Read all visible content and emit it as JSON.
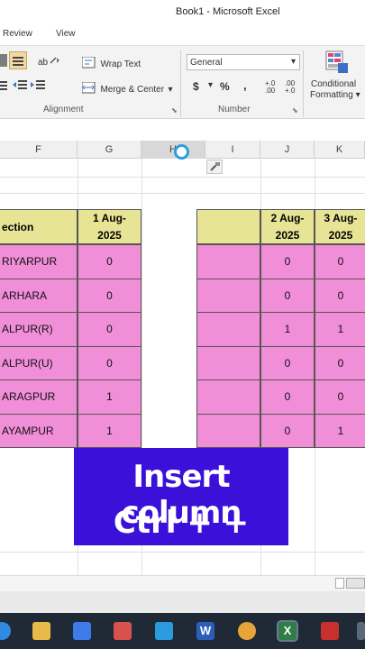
{
  "window": {
    "title": "Book1 - Microsoft Excel"
  },
  "tabs": [
    "Review",
    "View"
  ],
  "ribbon": {
    "alignment": {
      "wrap_text": "Wrap Text",
      "merge_center": "Merge & Center",
      "group_label": "Alignment"
    },
    "number": {
      "format_value": "General",
      "currency": "$",
      "percent": "%",
      "comma": ",",
      "inc_decimal": "+.0 .00",
      "dec_decimal": ".00 +.0",
      "group_label": "Number"
    },
    "styles": {
      "conditional_formatting_line1": "Conditional",
      "conditional_formatting_line2": "Formatting"
    }
  },
  "columns": [
    "F",
    "G",
    "H",
    "I",
    "J",
    "K"
  ],
  "sheet": {
    "left_header": "ection",
    "g_header_line1": "1 Aug-",
    "g_header_line2": "2025",
    "j_header_line1": "2 Aug-",
    "j_header_line2": "2025",
    "k_header_line1": "3 Aug-",
    "k_header_line2": "2025",
    "rows": [
      {
        "f": "RIYARPUR",
        "g": "0",
        "j": "0",
        "k": "0"
      },
      {
        "f": "ARHARA",
        "g": "0",
        "j": "0",
        "k": "0"
      },
      {
        "f": "ALPUR(R)",
        "g": "0",
        "j": "1",
        "k": "1"
      },
      {
        "f": "ALPUR(U)",
        "g": "0",
        "j": "0",
        "k": "0"
      },
      {
        "f": "ARAGPUR",
        "g": "1",
        "j": "0",
        "k": "0"
      },
      {
        "f": "AYAMPUR",
        "g": "1",
        "j": "0",
        "k": "1"
      }
    ]
  },
  "overlay": {
    "line1": "Insert column",
    "line2": "Ctrl + +"
  },
  "colors": {
    "header_fill": "#e8e496",
    "data_fill": "#f08ed8",
    "overlay_bg": "#3b10d8",
    "taskbar_bg": "#1f2a36"
  }
}
